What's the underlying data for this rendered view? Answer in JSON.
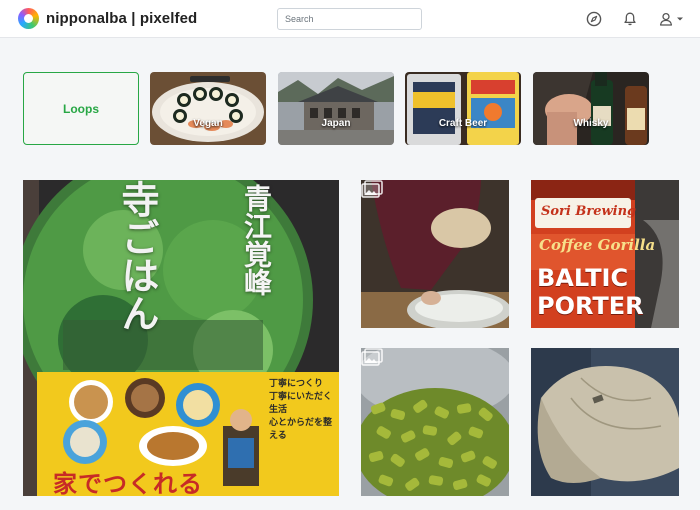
{
  "navbar": {
    "brand_text": "nipponalba | pixelfed",
    "search": {
      "placeholder": "Search",
      "value": ""
    },
    "icons": [
      "compass-icon",
      "bell-icon",
      "user-icon",
      "caret-down-icon"
    ]
  },
  "categories": [
    {
      "label": "Loops"
    },
    {
      "label": "Vegan"
    },
    {
      "label": "Japan"
    },
    {
      "label": "Craft Beer"
    },
    {
      "label": "Whisky"
    }
  ],
  "book": {
    "title_vertical": "寺ごはん",
    "author_vertical": "青江覚峰",
    "subtitle": "家でつくれる",
    "band_lines": [
      "丁寧につくり",
      "丁寧にいただく生活",
      "心とからだを整える"
    ]
  },
  "beer_can": {
    "brand": "Sori Brewing",
    "name": "Coffee Gorilla",
    "style_lines": [
      "BALTIC",
      "PORTER"
    ]
  },
  "colors": {
    "accent_green": "#28a745",
    "navbar_bg": "#ffffff",
    "page_bg": "#f4f6f8"
  }
}
